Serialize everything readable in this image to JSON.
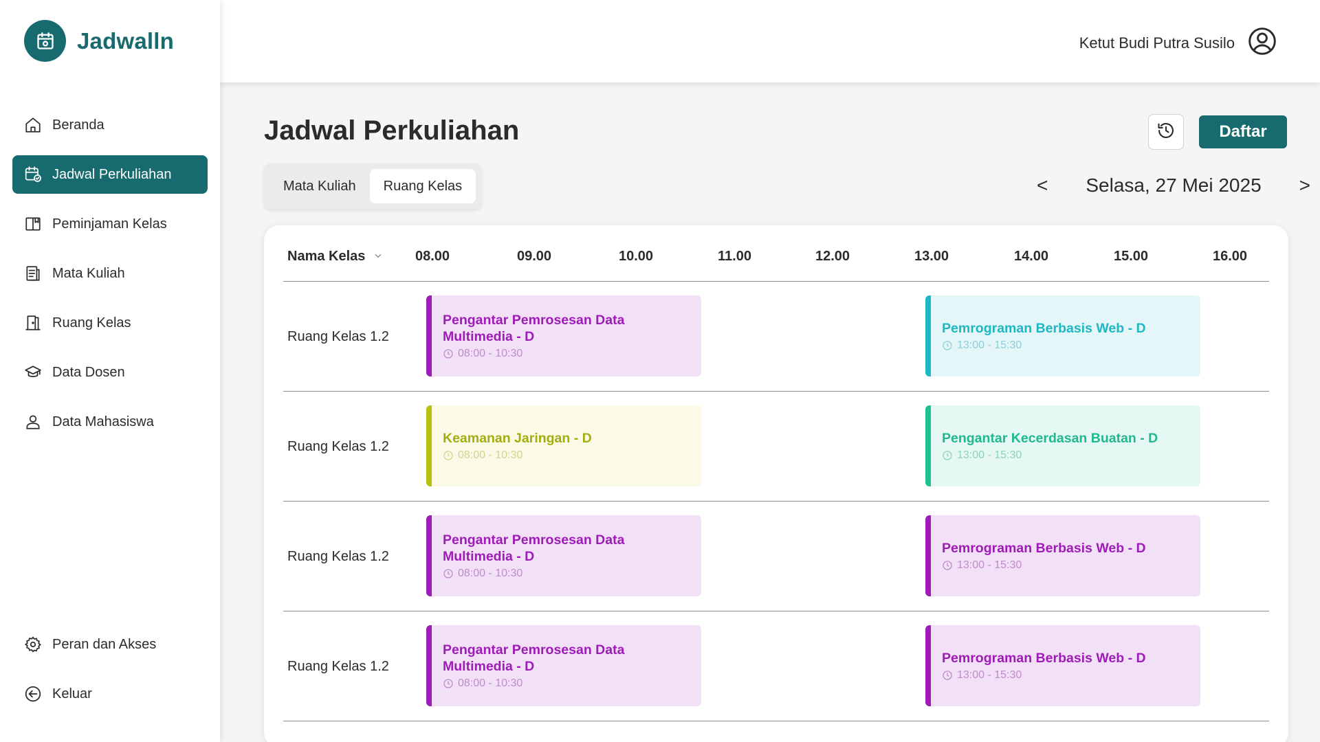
{
  "app": {
    "name": "Jadwalln"
  },
  "user": {
    "name": "Ketut Budi Putra Susilo"
  },
  "sidebar": {
    "items": [
      {
        "label": "Beranda",
        "icon": "home-icon"
      },
      {
        "label": "Jadwal Perkuliahan",
        "icon": "calendar-check-icon",
        "active": true
      },
      {
        "label": "Peminjaman Kelas",
        "icon": "book-open-icon"
      },
      {
        "label": "Mata Kuliah",
        "icon": "document-list-icon"
      },
      {
        "label": "Ruang Kelas",
        "icon": "door-icon"
      },
      {
        "label": "Data Dosen",
        "icon": "graduation-cap-icon"
      },
      {
        "label": "Data Mahasiswa",
        "icon": "user-icon"
      }
    ],
    "bottom_items": [
      {
        "label": "Peran dan Akses",
        "icon": "gear-icon"
      },
      {
        "label": "Keluar",
        "icon": "logout-icon"
      }
    ]
  },
  "main": {
    "title": "Jadwal Perkuliahan",
    "daftar_label": "Daftar",
    "tabs": [
      {
        "label": "Mata Kuliah",
        "active": false
      },
      {
        "label": "Ruang Kelas",
        "active": true
      }
    ],
    "date": {
      "prev": "<",
      "label": "Selasa, 27 Mei 2025",
      "next": ">"
    }
  },
  "table": {
    "name_header": "Nama Kelas",
    "times": [
      "08.00",
      "09.00",
      "10.00",
      "11.00",
      "12.00",
      "13.00",
      "14.00",
      "15.00",
      "16.00"
    ],
    "rows": [
      {
        "name": "Ruang Kelas 1.2",
        "events": [
          {
            "title": "Pengantar Pemrosesan Data Multimedia - D",
            "time": "08:00 - 10:30",
            "color": "purple"
          },
          {
            "title": "Pemrograman Berbasis Web - D",
            "time": "13:00 - 15:30",
            "color": "cyan"
          }
        ]
      },
      {
        "name": "Ruang Kelas 1.2",
        "events": [
          {
            "title": "Keamanan Jaringan - D",
            "time": "08:00 - 10:30",
            "color": "lime"
          },
          {
            "title": "Pengantar Kecerdasan Buatan - D",
            "time": "13:00 - 15:30",
            "color": "mint"
          }
        ]
      },
      {
        "name": "Ruang Kelas 1.2",
        "events": [
          {
            "title": "Pengantar Pemrosesan Data Multimedia - D",
            "time": "08:00 - 10:30",
            "color": "purple"
          },
          {
            "title": "Pemrograman Berbasis Web - D",
            "time": "13:00 - 15:30",
            "color": "purple"
          }
        ]
      },
      {
        "name": "Ruang Kelas 1.2",
        "events": [
          {
            "title": "Pengantar Pemrosesan Data Multimedia - D",
            "time": "08:00 - 10:30",
            "color": "purple"
          },
          {
            "title": "Pemrograman Berbasis Web - D",
            "time": "13:00 - 15:30",
            "color": "purple"
          }
        ]
      }
    ]
  },
  "colors": {
    "primary": "#176a6e",
    "purple": "#9e1bb8",
    "cyan": "#1eb8c4",
    "lime": "#b6c20f",
    "mint": "#20c094"
  }
}
